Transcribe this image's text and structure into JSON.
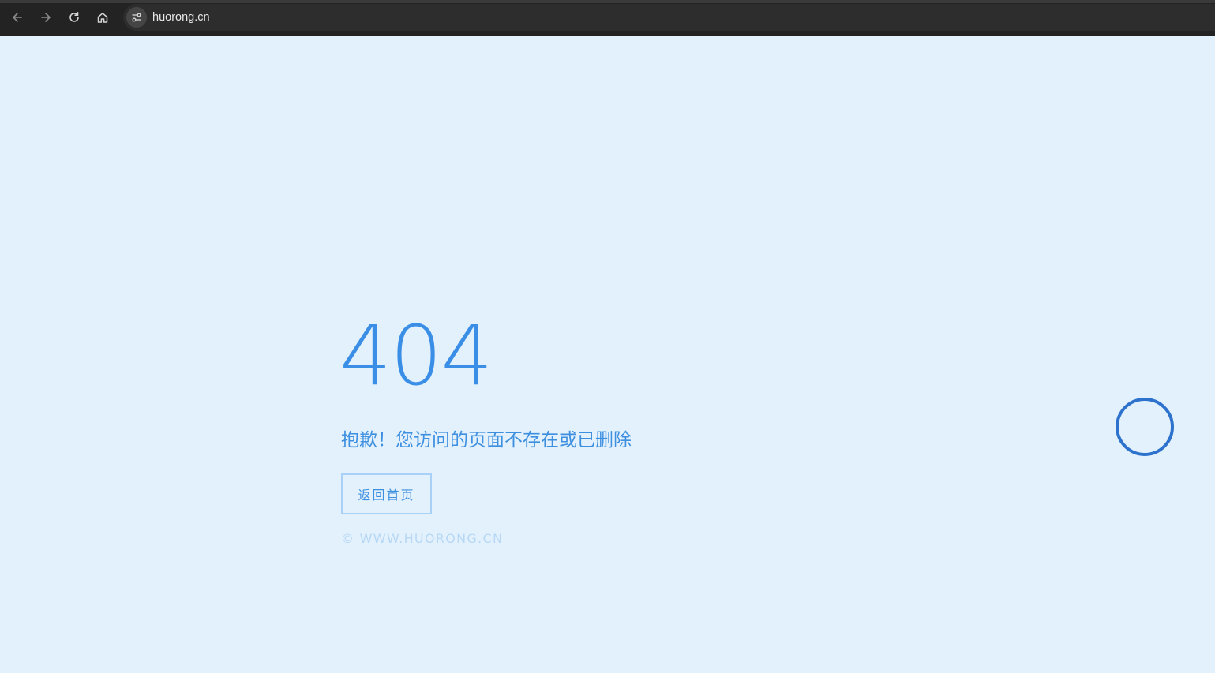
{
  "browser": {
    "url": "huorong.cn",
    "icons": {
      "back": "arrow-left-icon",
      "forward": "arrow-right-icon",
      "reload": "reload-icon",
      "home": "home-icon",
      "site_info": "tune-icon",
      "bookmark": "star-icon"
    },
    "bookmark_glyph": "★"
  },
  "page": {
    "error_code": "404",
    "message": "抱歉！您访问的页面不存在或已删除",
    "home_button_label": "返回首页",
    "copyright": "© WWW.HUORONG.CN"
  },
  "colors": {
    "background": "#e3f1fd",
    "accent": "#3a8ee6",
    "button_border": "#a9d1f7",
    "copyright": "#b7d8f5",
    "ring": "#2d72cc"
  }
}
